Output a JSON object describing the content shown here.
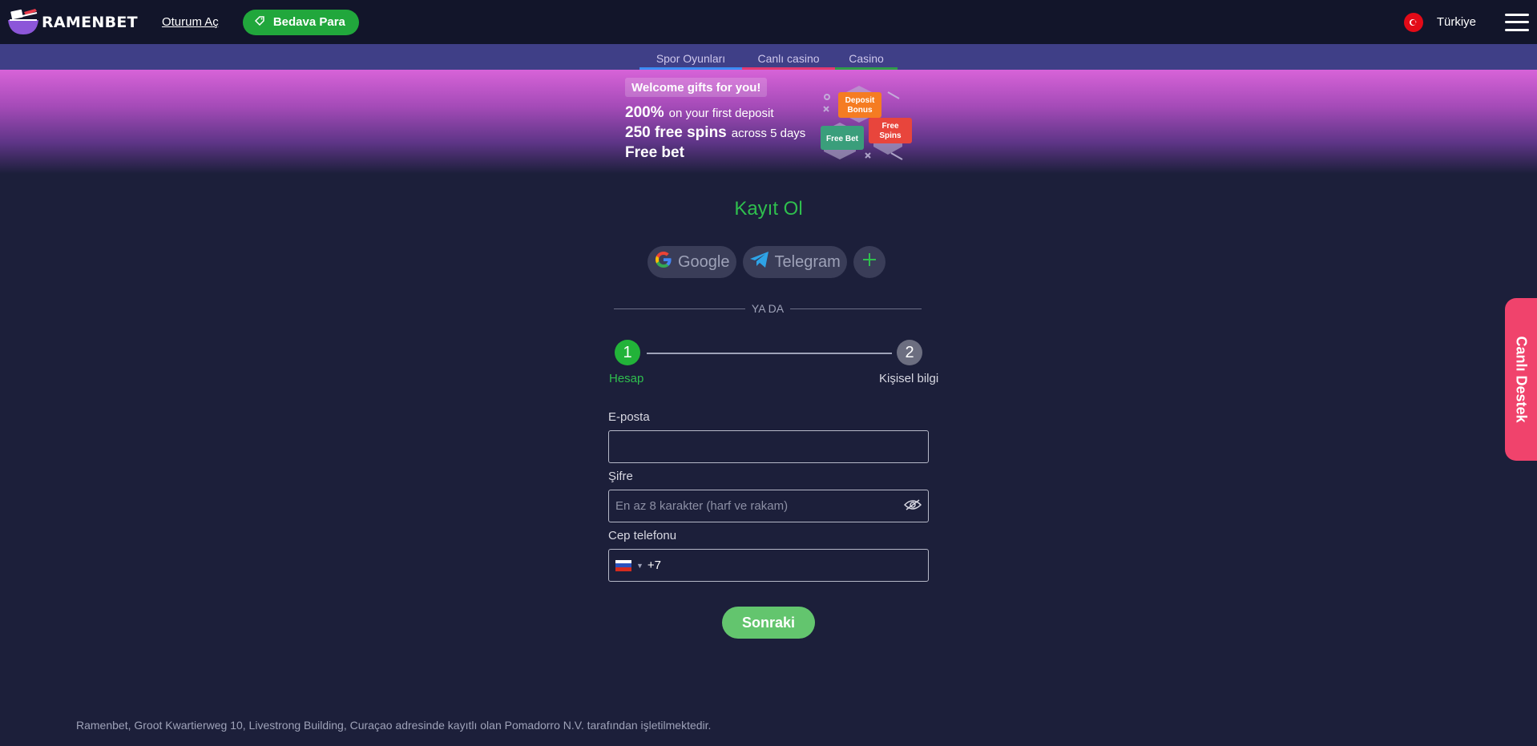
{
  "header": {
    "logo_text": "RAMENBET",
    "login_label": "Oturum Aç",
    "free_label": "Bedava Para",
    "country": "Türkiye"
  },
  "tabs": [
    {
      "label": "Spor Oyunları",
      "color": "#3d8df5"
    },
    {
      "label": "Canlı casino",
      "color": "#e23a72"
    },
    {
      "label": "Casino",
      "color": "#2f9e4a"
    }
  ],
  "banner": {
    "welcome": "Welcome gifts for you!",
    "line1_bold": "200%",
    "line1_text": "on your first deposit",
    "line2_bold": "250 free spins",
    "line2_text": "across 5 days",
    "line3_bold": "Free bet",
    "tag_deposit": "Deposit Bonus",
    "tag_freebet": "Free Bet",
    "tag_spins": "Free Spins"
  },
  "form": {
    "title": "Kayıt Ol",
    "social": {
      "google": "Google",
      "telegram": "Telegram"
    },
    "divider": "YA DA",
    "steps": [
      {
        "number": "1",
        "label": "Hesap"
      },
      {
        "number": "2",
        "label": "Kişisel bilgi"
      }
    ],
    "email": {
      "label": "E-posta",
      "value": "",
      "placeholder": ""
    },
    "password": {
      "label": "Şifre",
      "placeholder": "En az 8 karakter (harf ve rakam)"
    },
    "phone": {
      "label": "Cep telefonu",
      "dial_code": "+7"
    },
    "next_label": "Sonraki"
  },
  "support_label": "Canlı Destek",
  "footer_text": "Ramenbet, Groot Kwartierweg 10, Livestrong Building, Curaçao adresinde kayıtlı olan Pomadorro N.V. tarafından işletilmektedir.",
  "colors": {
    "accent_green": "#21a73c",
    "support_pink": "#f0436c",
    "background": "#1c1f3a"
  }
}
